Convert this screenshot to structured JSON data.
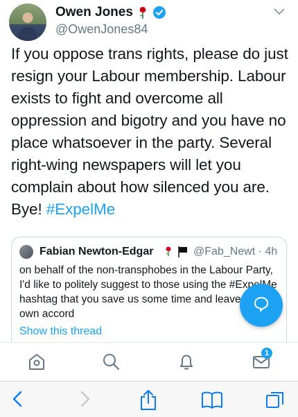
{
  "tweet": {
    "author_name": "Owen Jones",
    "author_handle": "@OwenJones84",
    "text": "If you oppose trans rights, please do just resign your Labour membership. Labour exists to fight and overcome all oppression and bigotry and you have no place whatsoever in the party. Several right-wing newspapers will let you complain about how silenced you are. Bye! ",
    "hashtag": "#ExpelMe"
  },
  "quoted": {
    "author_name": "Fabian Newton-Edgar",
    "author_handle": "@Fab_Newt",
    "separator": "·",
    "time": "4h",
    "text": "on behalf of the non-transphobes in the Labour Party, I'd like to politely suggest to those using the #ExpelMe hashtag that you save us some time and leave of your own accord",
    "show_thread": "Show this thread"
  },
  "tabbar": {
    "items": [
      "home-icon",
      "search-icon",
      "notifications-icon",
      "messages-icon"
    ],
    "messages_badge": "1"
  },
  "browser_toolbar": {
    "items": [
      "back-icon",
      "forward-icon",
      "share-icon",
      "bookmarks-icon",
      "tabs-icon"
    ]
  },
  "colors": {
    "accent": "#1da1f2",
    "text": "#14171a",
    "secondary_text": "#657786",
    "rose": "#d0021b"
  }
}
